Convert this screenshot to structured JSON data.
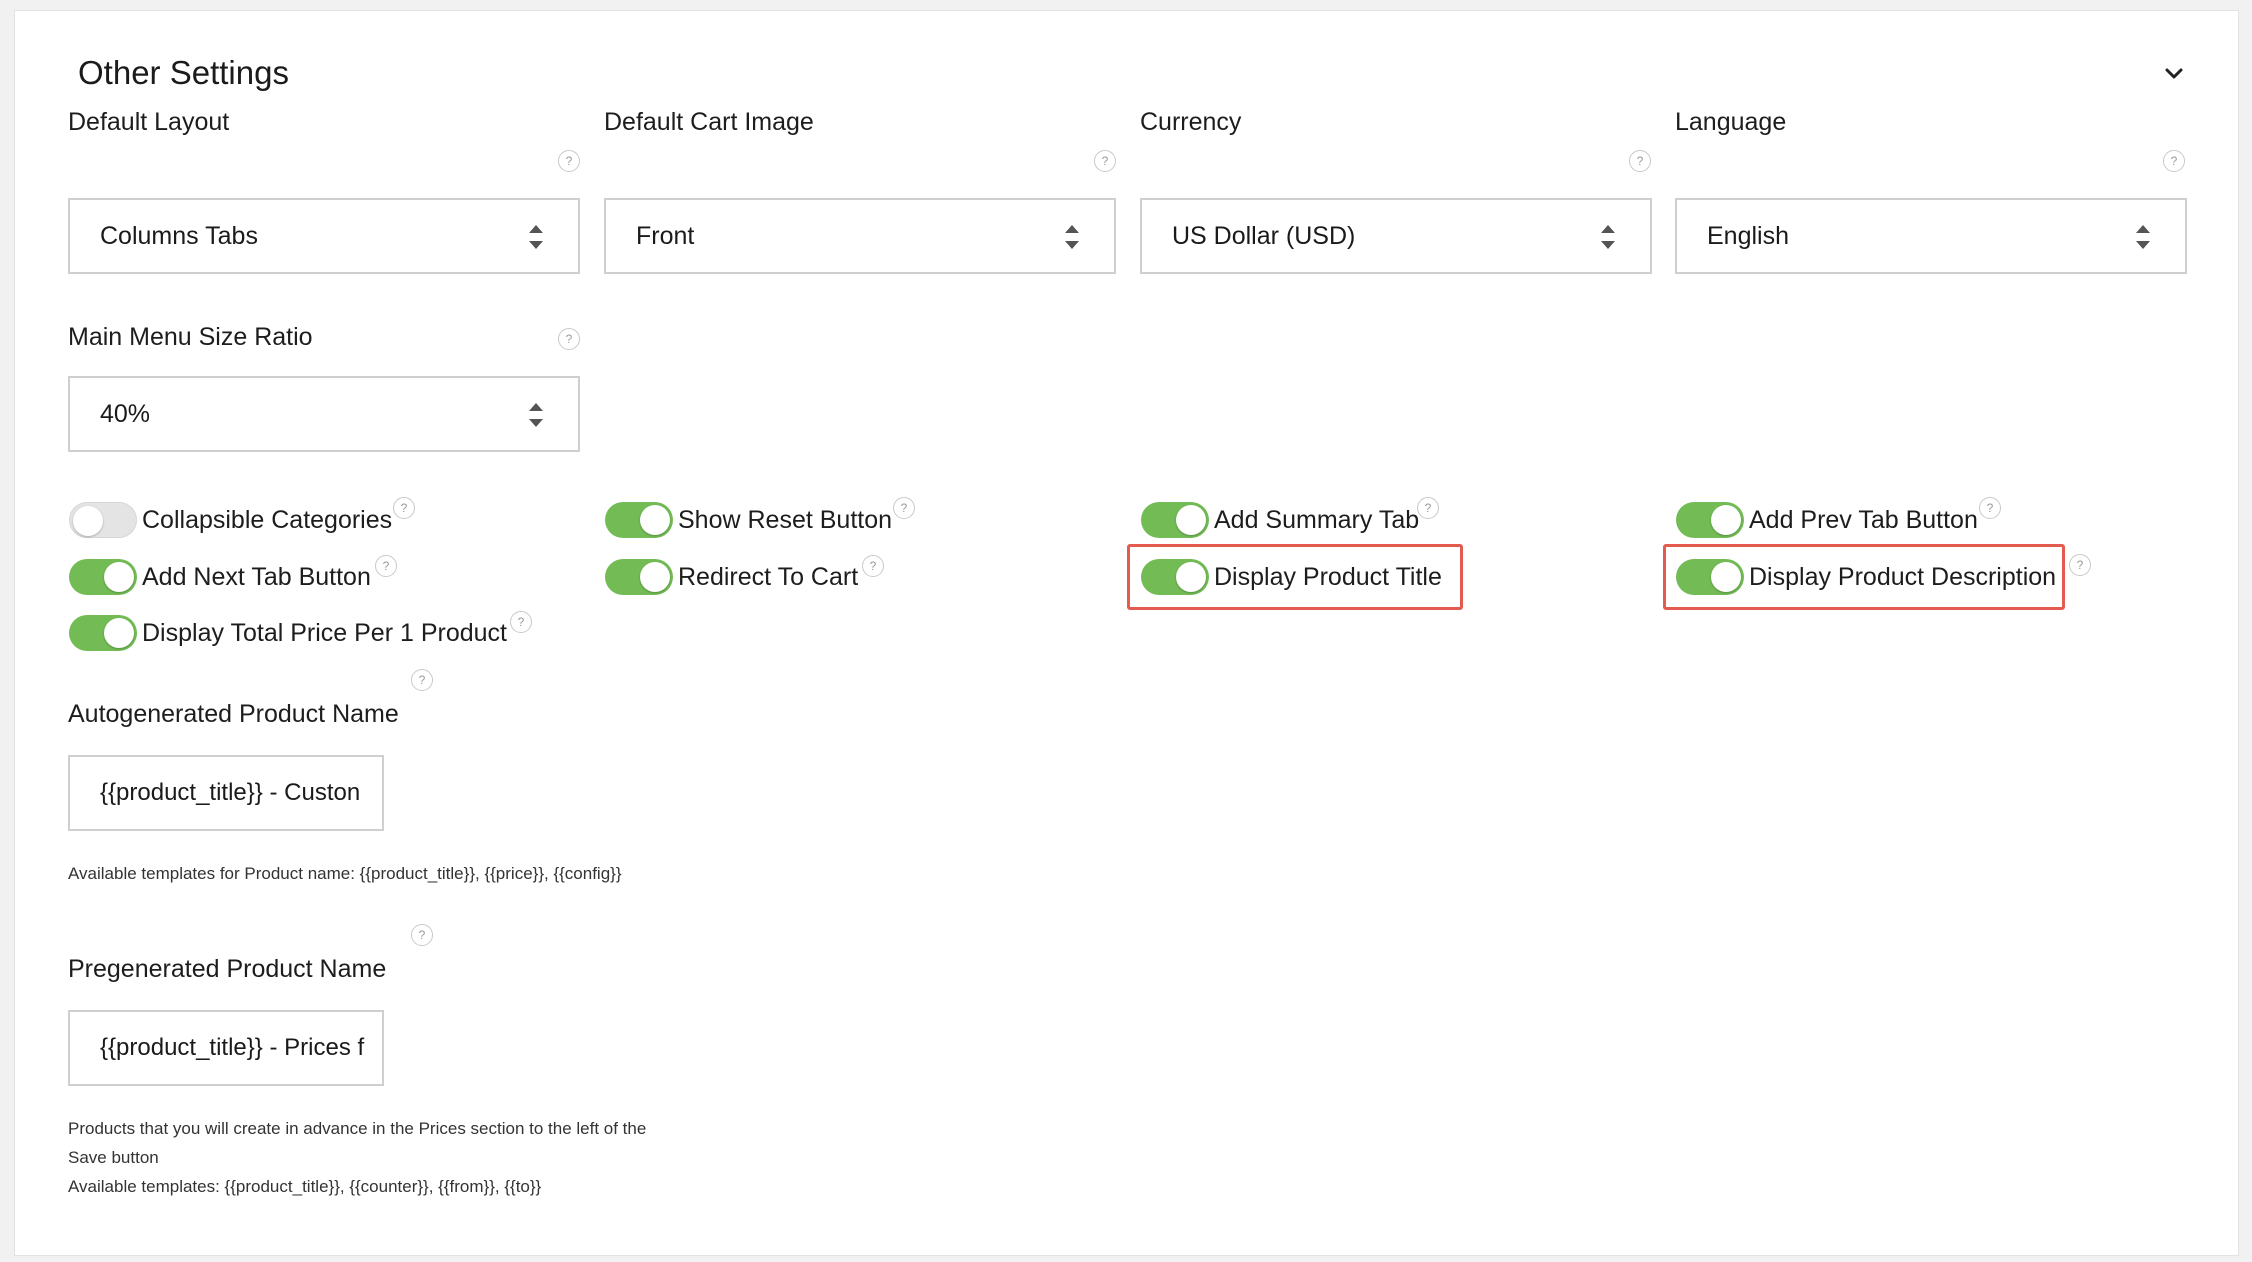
{
  "panel": {
    "title": "Other Settings",
    "collapse_icon": "chevron-down-icon"
  },
  "fields": {
    "default_layout": {
      "label": "Default Layout",
      "value": "Columns Tabs"
    },
    "default_cart_image": {
      "label": "Default Cart Image",
      "value": "Front"
    },
    "currency": {
      "label": "Currency",
      "value": "US Dollar (USD)"
    },
    "language": {
      "label": "Language",
      "value": "English"
    },
    "main_menu_size_ratio": {
      "label": "Main Menu Size Ratio",
      "value": "40%"
    }
  },
  "help_glyph": "?",
  "toggles": {
    "collapsible_categories": {
      "label": "Collapsible Categories",
      "on": false
    },
    "show_reset_button": {
      "label": "Show Reset Button",
      "on": true
    },
    "add_summary_tab": {
      "label": "Add Summary Tab",
      "on": true
    },
    "add_prev_tab_button": {
      "label": "Add Prev Tab Button",
      "on": true
    },
    "add_next_tab_button": {
      "label": "Add Next Tab Button",
      "on": true
    },
    "redirect_to_cart": {
      "label": "Redirect To Cart",
      "on": true
    },
    "display_product_title": {
      "label": "Display Product Title",
      "on": true
    },
    "display_product_description": {
      "label": "Display Product Description",
      "on": true
    },
    "display_total_price": {
      "label": "Display Total Price Per 1 Product",
      "on": true
    }
  },
  "autogenerated": {
    "label": "Autogenerated Product Name",
    "value": "{{product_title}} - Custon",
    "note": "Available templates for Product name: {{product_title}}, {{price}}, {{config}}"
  },
  "pregenerated": {
    "label": "Pregenerated Product Name",
    "value": "{{product_title}} - Prices f",
    "note_line1": "Products that you will create in advance in the Prices section to the left of the",
    "note_line2": "Save button",
    "note_line3": "Available templates: {{product_title}}, {{counter}}, {{from}}, {{to}}"
  },
  "colors": {
    "toggle_on": "#73bc55",
    "toggle_off": "#e4e4e4",
    "highlight": "#e35b4f"
  }
}
